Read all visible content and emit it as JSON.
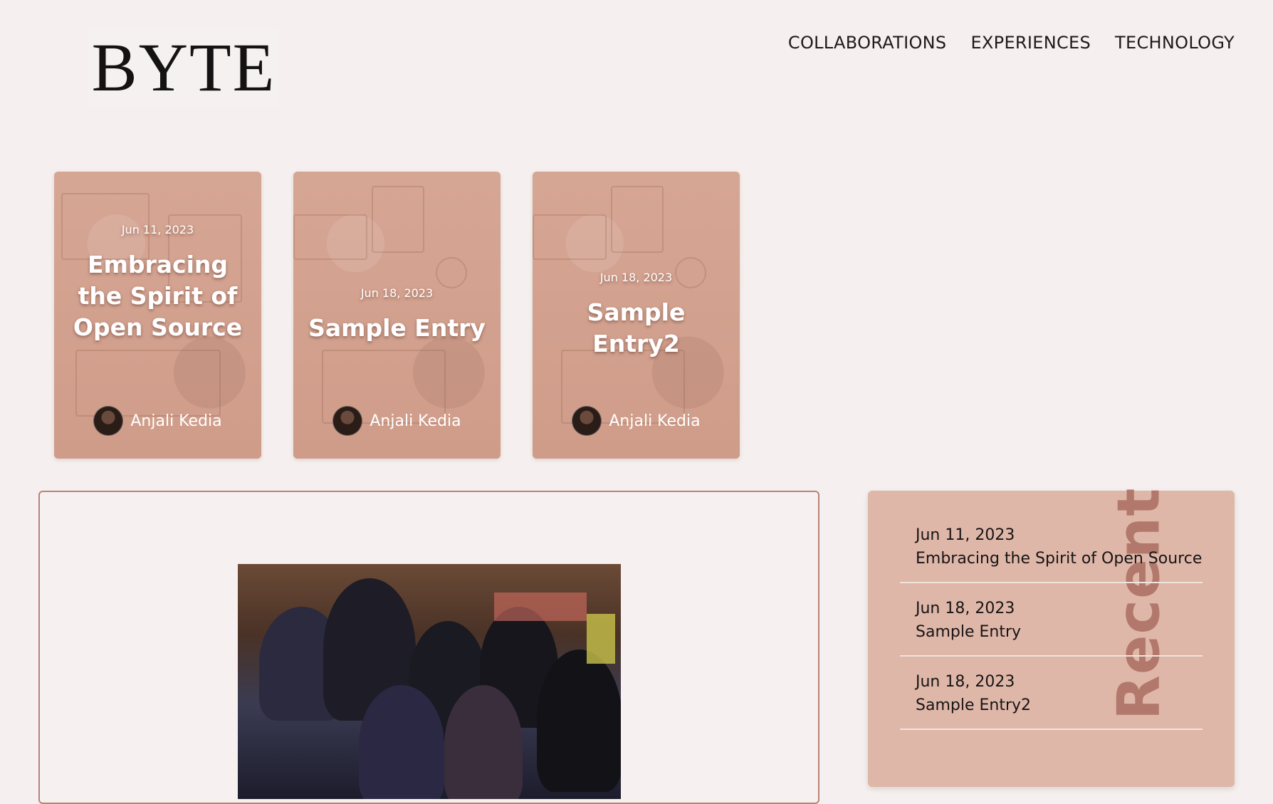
{
  "brand": {
    "logo_text": "BYTE"
  },
  "nav": {
    "items": [
      "COLLABORATIONS",
      "EXPERIENCES",
      "TECHNOLOGY"
    ]
  },
  "cards": [
    {
      "date": "Jun 11, 2023",
      "title": "Embracing the Spirit of Open Source",
      "author": "Anjali Kedia"
    },
    {
      "date": "Jun 18, 2023",
      "title": "Sample Entry",
      "author": "Anjali Kedia"
    },
    {
      "date": "Jun 18, 2023",
      "title": "Sample Entry2",
      "author": "Anjali Kedia"
    }
  ],
  "recent": {
    "heading": "Recent",
    "items": [
      {
        "date": "Jun 11, 2023",
        "title": "Embracing the Spirit of Open Source"
      },
      {
        "date": "Jun 18, 2023",
        "title": "Sample Entry"
      },
      {
        "date": "Jun 18, 2023",
        "title": "Sample Entry2"
      }
    ]
  },
  "theme": {
    "card_tint": "#d29f8d",
    "panel_border": "#b98374",
    "recent_bg": "#deb7a9",
    "recent_heading": "#b1786b"
  }
}
